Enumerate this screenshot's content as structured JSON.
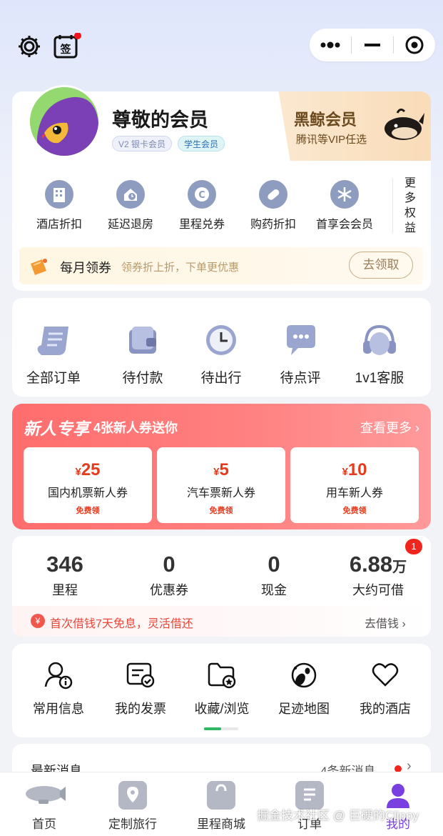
{
  "topbar": {
    "icons": [
      "gear-icon",
      "sign-in-calendar-icon"
    ],
    "capsule_icons": [
      "more-dots-icon",
      "minimize-icon",
      "close-target-icon"
    ]
  },
  "member": {
    "name": "尊敬的会员",
    "badges": [
      "V2 银卡会员",
      "学生会员"
    ],
    "vip_title": "黑鲸会员",
    "vip_sub": "腾讯等VIP任选",
    "benefits": [
      {
        "label": "酒店折扣",
        "icon": "hotel-building-icon"
      },
      {
        "label": "延迟退房",
        "icon": "house-clock-icon"
      },
      {
        "label": "里程兑券",
        "icon": "mileage-coin-icon"
      },
      {
        "label": "购药折扣",
        "icon": "pill-icon"
      },
      {
        "label": "首享会会员",
        "icon": "snowflake-icon"
      }
    ],
    "more_benefits": "更多权益",
    "coupon_title": "每月领券",
    "coupon_desc": "领券折上折，下单更优惠",
    "coupon_button": "去领取"
  },
  "orders": [
    {
      "label": "全部订单",
      "icon": "scroll-list-icon"
    },
    {
      "label": "待付款",
      "icon": "wallet-icon"
    },
    {
      "label": "待出行",
      "icon": "clock-icon"
    },
    {
      "label": "待点评",
      "icon": "chat-bubble-icon"
    },
    {
      "label": "1v1客服",
      "icon": "headset-icon"
    }
  ],
  "newcomer": {
    "title": "新人专享",
    "subtitle": "4张新人券送你",
    "more": "查看更多",
    "currency": "¥",
    "coupons": [
      {
        "amount": "25",
        "name": "国内机票新人券",
        "tag": "免费领"
      },
      {
        "amount": "5",
        "name": "汽车票新人券",
        "tag": "免费领"
      },
      {
        "amount": "10",
        "name": "用车新人券",
        "tag": "免费领"
      }
    ]
  },
  "stats": {
    "items": [
      {
        "value": "346",
        "unit": "",
        "label": "里程"
      },
      {
        "value": "0",
        "unit": "",
        "label": "优惠券"
      },
      {
        "value": "0",
        "unit": "",
        "label": "现金"
      },
      {
        "value": "6.88",
        "unit": "万",
        "label": "大约可借"
      }
    ],
    "badge_count": "1",
    "loan_text": "首次借钱7天免息，灵活借还",
    "loan_action": "去借钱",
    "currency_symbol": "¥"
  },
  "tools": {
    "items": [
      {
        "label": "常用信息",
        "icon": "person-info-icon"
      },
      {
        "label": "我的发票",
        "icon": "invoice-check-icon"
      },
      {
        "label": "收藏/浏览",
        "icon": "folder-star-icon"
      },
      {
        "label": "足迹地图",
        "icon": "footprint-icon"
      },
      {
        "label": "我的酒店",
        "icon": "heart-icon"
      }
    ]
  },
  "messages": {
    "title": "最新消息",
    "count_text": "4条新消息"
  },
  "tabbar": {
    "tabs": [
      {
        "label": "首页",
        "icon": "airship-icon"
      },
      {
        "label": "定制旅行",
        "icon": "map-pin-icon"
      },
      {
        "label": "里程商城",
        "icon": "shopping-bag-icon"
      },
      {
        "label": "订单",
        "icon": "order-book-icon"
      },
      {
        "label": "我的",
        "icon": "person-icon"
      }
    ],
    "active_color": "#7a3fe0"
  },
  "watermark": "掘金技术社区 @ 巨硬的Clippy",
  "colors": {
    "accent_red": "#e63a1e",
    "vip_gold": "#6b4a1d",
    "newcomer_gradient": "#ff6d6d"
  }
}
